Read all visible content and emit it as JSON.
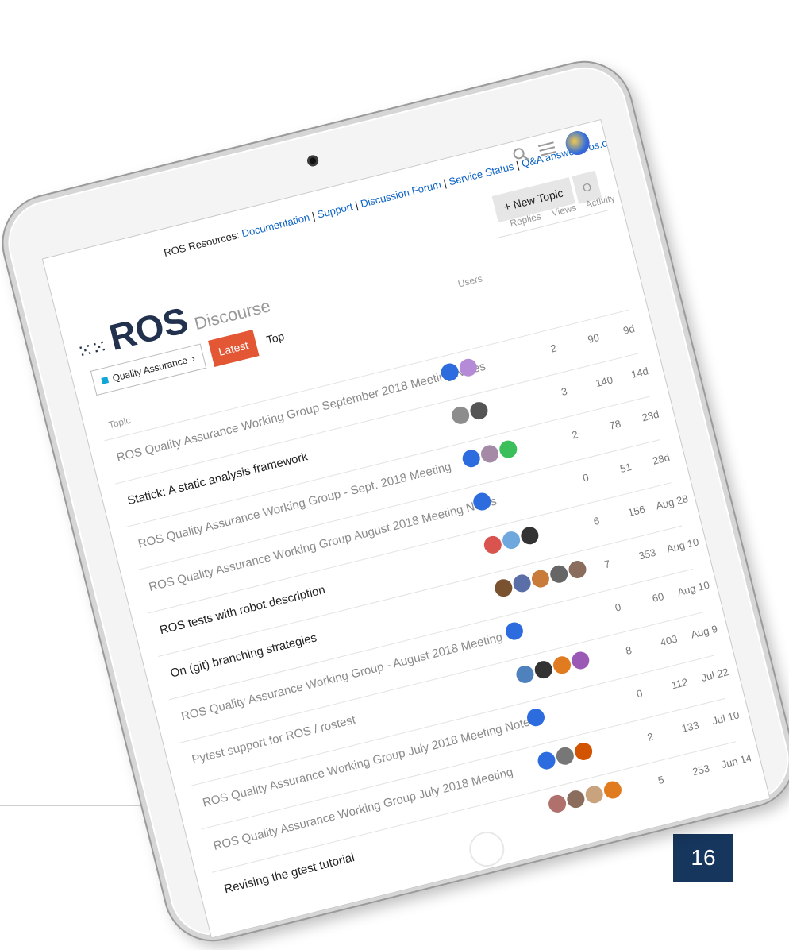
{
  "page_number": "16",
  "header": {
    "resources_prefix": "ROS Resources: ",
    "links": [
      "Documentation",
      "Support",
      "Discussion Forum",
      "Service Status",
      "Q&A answers.ros.org"
    ],
    "separator": " | ",
    "search_icon": "search-icon",
    "menu_icon": "hamburger-menu-icon"
  },
  "actions": {
    "new_topic_label": "+ New Topic",
    "notifications_label": "O"
  },
  "logo": {
    "dots": "⁙⁙",
    "name": "ROS",
    "sub": "Discourse"
  },
  "columns": {
    "users": "Users",
    "replies": "Replies",
    "views": "Views",
    "activity": "Activity",
    "topic": "Topic"
  },
  "filters": {
    "category": "Quality Assurance",
    "latest": "Latest",
    "top": "Top"
  },
  "topics": [
    {
      "title": "ROS Quality Assurance Working Group September 2018 Meeting Notes",
      "read": true,
      "replies": "2",
      "views": "90",
      "activity": "9d",
      "users": [
        "#2d6cdf",
        "#b58bd8"
      ]
    },
    {
      "title": "Statick: A static analysis framework",
      "read": false,
      "replies": "3",
      "views": "140",
      "activity": "14d",
      "users": [
        "#8d8d8d",
        "#555555"
      ]
    },
    {
      "title": "ROS Quality Assurance Working Group - Sept. 2018 Meeting",
      "read": true,
      "replies": "2",
      "views": "78",
      "activity": "23d",
      "users": [
        "#2d6cdf",
        "#a58aa8",
        "#3bbf5a"
      ]
    },
    {
      "title": "ROS Quality Assurance Working Group August 2018 Meeting Notes",
      "read": true,
      "replies": "0",
      "views": "51",
      "activity": "28d",
      "users": [
        "#2d6cdf"
      ]
    },
    {
      "title": "ROS tests with robot description",
      "read": false,
      "replies": "6",
      "views": "156",
      "activity": "Aug 28",
      "users": [
        "#d9534f",
        "#6fa8dc",
        "#333333"
      ]
    },
    {
      "title": "On (git) branching strategies",
      "read": false,
      "replies": "7",
      "views": "353",
      "activity": "Aug 10",
      "users": [
        "#7a5230",
        "#5a6fa8",
        "#c97b3a",
        "#666666",
        "#8a6d5c"
      ]
    },
    {
      "title": "ROS Quality Assurance Working Group - August 2018 Meeting",
      "read": true,
      "replies": "0",
      "views": "60",
      "activity": "Aug 10",
      "users": [
        "#2d6cdf"
      ]
    },
    {
      "title": "Pytest support for ROS / rostest",
      "read": true,
      "replies": "8",
      "views": "403",
      "activity": "Aug 9",
      "users": [
        "#4f81bd",
        "#333333",
        "#e07b1f",
        "#9b59b6"
      ]
    },
    {
      "title": "ROS Quality Assurance Working Group July 2018 Meeting Notes",
      "read": true,
      "replies": "0",
      "views": "112",
      "activity": "Jul 22",
      "users": [
        "#2d6cdf"
      ]
    },
    {
      "title": "ROS Quality Assurance Working Group July 2018 Meeting",
      "read": true,
      "replies": "2",
      "views": "133",
      "activity": "Jul 10",
      "users": [
        "#2d6cdf",
        "#777777",
        "#d35400"
      ]
    },
    {
      "title": "Revising the gtest tutorial",
      "read": false,
      "replies": "5",
      "views": "253",
      "activity": "Jun 14",
      "users": [
        "#b0706b",
        "#8a6d5c",
        "#c9a27e",
        "#e07b1f"
      ]
    }
  ]
}
